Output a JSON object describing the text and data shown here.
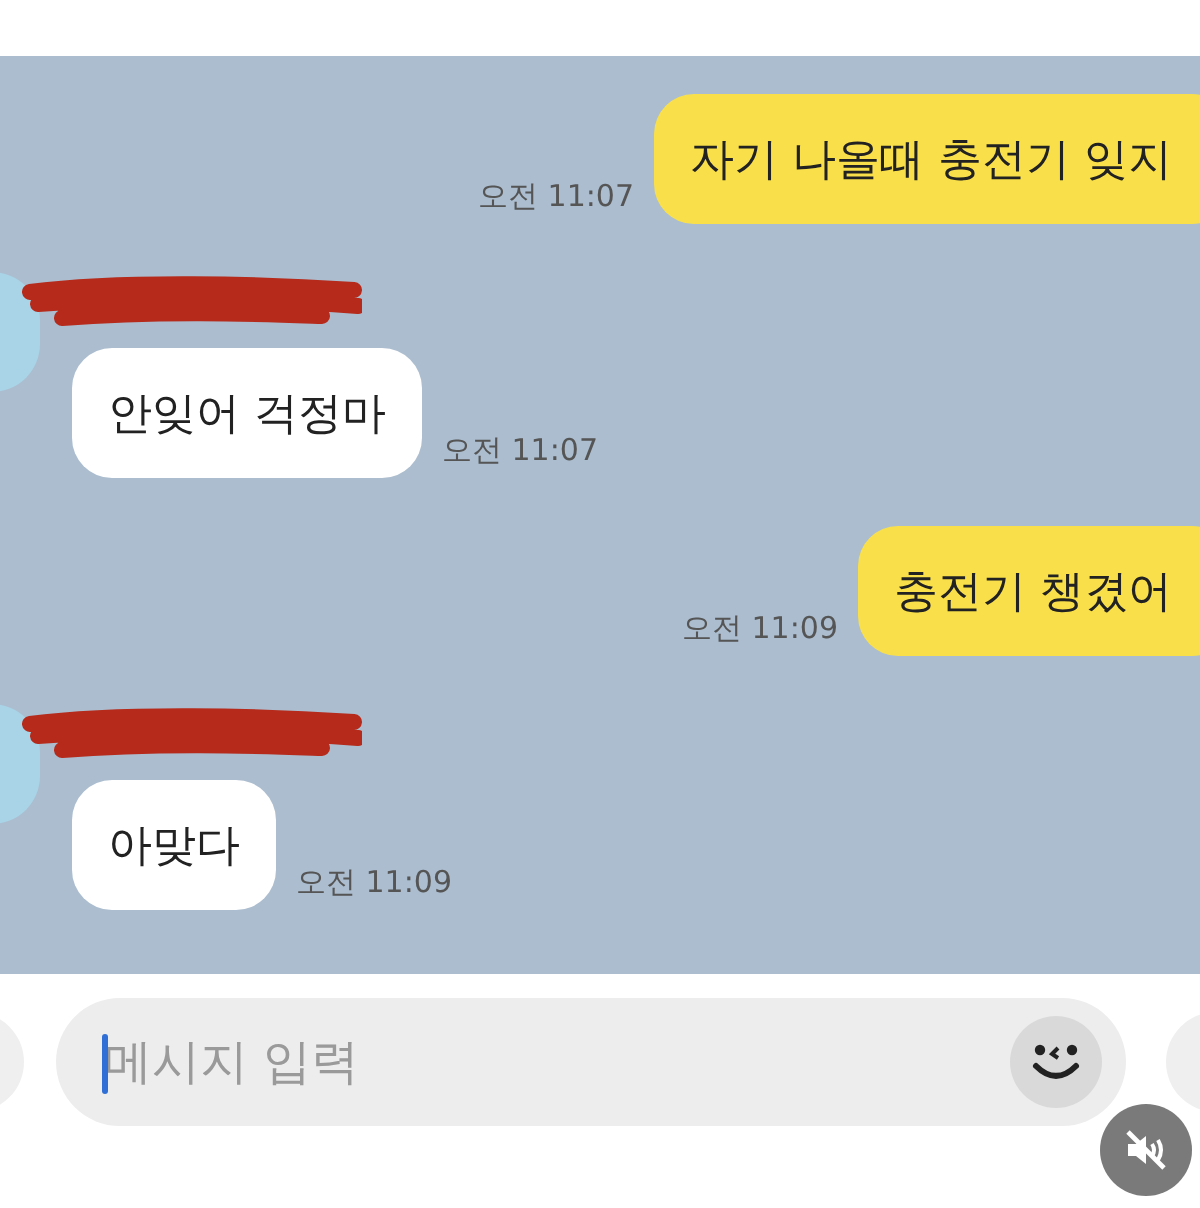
{
  "messages": [
    {
      "kind": "sent",
      "text": "자기 나올때 충전기 잊지",
      "time": "오전 11:07"
    },
    {
      "kind": "received",
      "text": "안잊어 걱정마",
      "time": "오전 11:07"
    },
    {
      "kind": "sent",
      "text": "충전기 챙겼어",
      "time": "오전 11:09"
    },
    {
      "kind": "received",
      "text": "아맞다",
      "time": "오전 11:09"
    }
  ],
  "composer": {
    "placeholder": "메시지 입력"
  }
}
